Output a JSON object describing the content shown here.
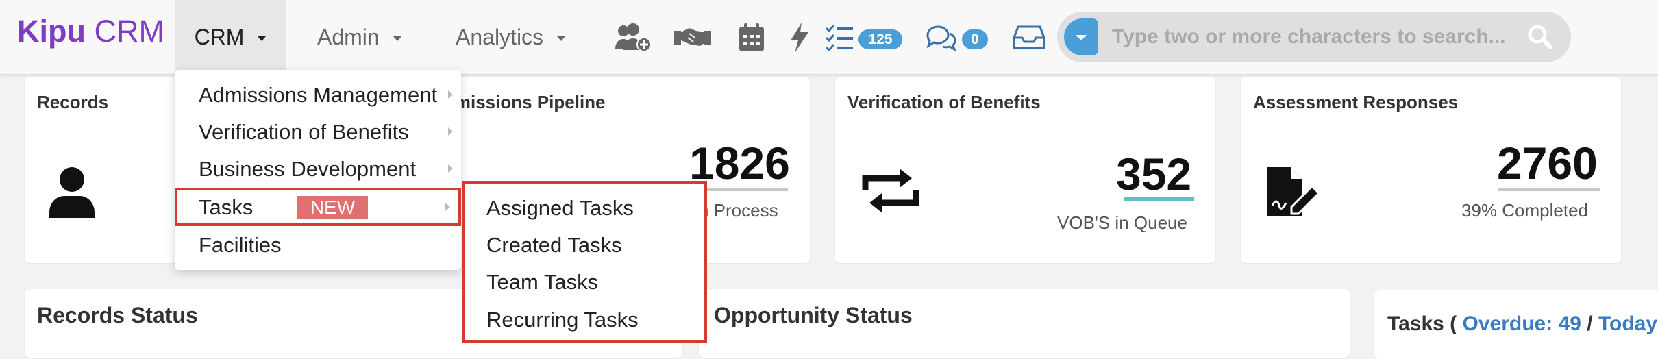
{
  "brand": {
    "name_bold": "Kipu",
    "name_light": " CRM",
    "color": "#7d3fc2"
  },
  "nav": {
    "crm": "CRM",
    "admin": "Admin",
    "analytics": "Analytics"
  },
  "toolbar": {
    "icons": [
      "add-user-icon",
      "handshake-icon",
      "calendar-icon",
      "bolt-icon",
      "task-list-icon",
      "chat-icon",
      "inbox-icon"
    ],
    "tasks_count": "125",
    "messages_count": "0"
  },
  "search": {
    "placeholder": "Type two or more characters to search..."
  },
  "cards": [
    {
      "title": "Records"
    },
    {
      "title": "dmissions Pipeline",
      "value": "1826",
      "caption": "n Process"
    },
    {
      "title": "Verification of Benefits",
      "value": "352",
      "caption": "VOB'S in Queue",
      "underline": "#5bbfc4"
    },
    {
      "title": "Assessment Responses",
      "value": "2760",
      "caption": "39% Completed",
      "underline": "#c8c8c8"
    }
  ],
  "sections": {
    "records_status": "Records Status",
    "opportunity_status": "Opportunity Status"
  },
  "tasks_summary": {
    "prefix": "Tasks ( ",
    "overdue": "Overdue: 49",
    "sep": " / ",
    "today": "Today:"
  },
  "crm_menu": {
    "items": [
      "Admissions Management",
      "Verification of Benefits",
      "Business Development",
      "Tasks",
      "Facilities"
    ],
    "new_badge": "NEW"
  },
  "tasks_submenu": {
    "items": [
      "Assigned Tasks",
      "Created Tasks",
      "Team Tasks",
      "Recurring Tasks"
    ]
  },
  "colors": {
    "accent": "#4a9fd9",
    "highlight": "#d63b2f",
    "new_badge": "#e07070"
  }
}
